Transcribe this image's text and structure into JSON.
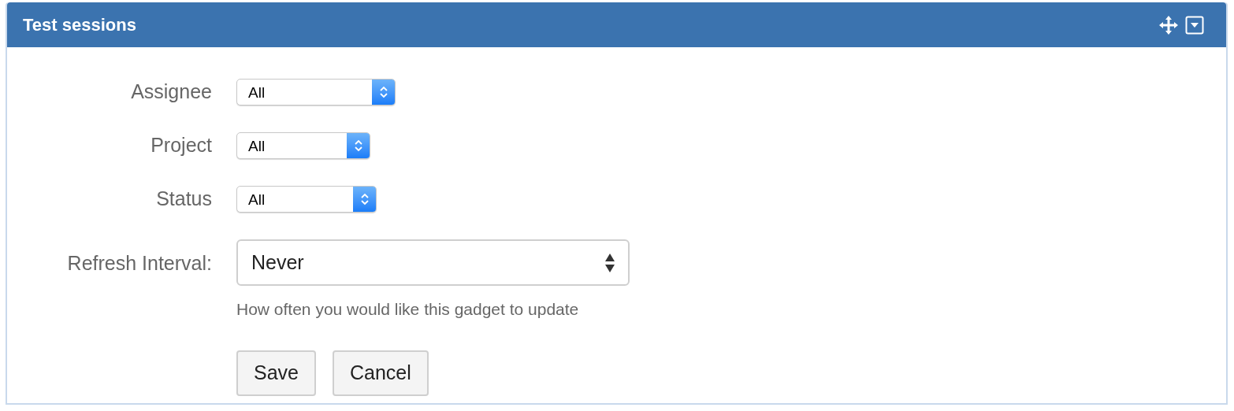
{
  "panel": {
    "title": "Test sessions"
  },
  "fields": [
    {
      "label": "Assignee",
      "kind": "mac-select",
      "value": "All"
    },
    {
      "label": "Project",
      "kind": "mac-select",
      "value": "All"
    },
    {
      "label": "Status",
      "kind": "mac-select",
      "value": "All"
    },
    {
      "label": "Refresh Interval:",
      "kind": "select",
      "value": "Never",
      "help": "How often you would like this gadget to update"
    }
  ],
  "buttons": [
    "Save",
    "Cancel"
  ]
}
